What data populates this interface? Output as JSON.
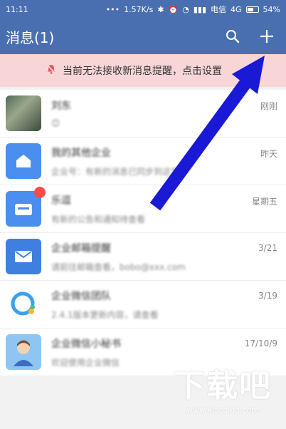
{
  "status_bar": {
    "time": "11:11",
    "network_speed": "1.57K/s",
    "carrier": "电信",
    "network": "4G",
    "battery": "54%"
  },
  "header": {
    "title": "消息(1)",
    "icons": {
      "search": "search-icon",
      "add": "plus-icon"
    }
  },
  "banner": {
    "text": "当前无法接收新消息提醒，点击设置",
    "icon": "bell-muted-icon"
  },
  "messages": [
    {
      "name": "刘东",
      "preview": "😊",
      "time": "刚刚"
    },
    {
      "name": "我的其他企业",
      "preview": "企业号：有新的消息已同步到这里",
      "time": "昨天"
    },
    {
      "name": "乐逗",
      "preview": "有新的公告和通知待查看",
      "time": "星期五"
    },
    {
      "name": "企业邮箱提醒",
      "preview": "请前往邮箱查看，bobo@xxx.com",
      "time": "3/21"
    },
    {
      "name": "企业微信团队",
      "preview": "2.4.1版本更新内容，请查看",
      "time": "3/19"
    },
    {
      "name": "企业微信小秘书",
      "preview": "欢迎使用企业微信",
      "time": "17/10/9"
    }
  ],
  "watermark": {
    "brand": "下载吧",
    "url": "www.xiazaiba.com"
  },
  "colors": {
    "header": "#4a6fb0",
    "banner": "#f8d6d8",
    "arrow": "#1a1ad6"
  }
}
